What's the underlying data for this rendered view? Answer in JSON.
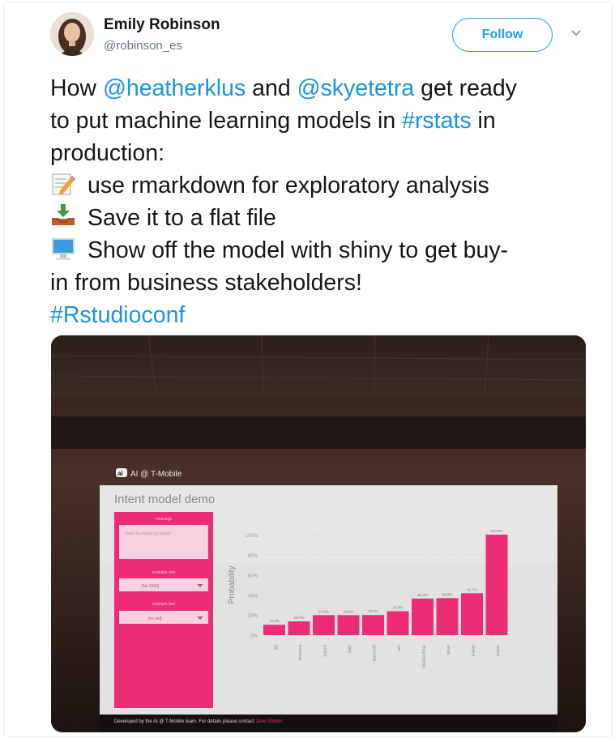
{
  "tweet": {
    "author_name": "Emily Robinson",
    "author_handle": "@robinson_es",
    "follow_label": "Follow",
    "line1": {
      "a": "How ",
      "m1": "@heatherklus",
      "b": " and ",
      "m2": "@skyetetra",
      "c": " get ready"
    },
    "line2": {
      "a": "to put machine learning models in ",
      "tag": "#rstats",
      "b": " in"
    },
    "line3": "production:",
    "bullets": [
      "use rmarkdown for exploratory analysis",
      "Save it to a flat file",
      "Show off the model with shiny to get buy-"
    ],
    "line7": "in from business stakeholders!",
    "hashtag": "#Rstudioconf",
    "colors": {
      "link": "#1b95e0",
      "accent": "#1da1f2",
      "slide_pink": "#ec2d75"
    }
  },
  "slide": {
    "brand": "AI @ T-Mobile",
    "brand_logo_text": "ai",
    "title": "Intent model demo",
    "form": {
      "message_label": "message",
      "message_value": "I want to unlock my phone",
      "select1_label": "example one",
      "select1_value": "[No SMS]",
      "select2_label": "example two",
      "select2_value": "[no sel]"
    },
    "footer_text": "Developed by the AI @ T-Mobile team. For details please contact",
    "footer_contact": "Jane Ellison.",
    "chart_data": {
      "type": "bar",
      "ylabel": "Probability",
      "yticks": [
        "100%",
        "80%",
        "60%",
        "40%",
        "20%",
        "0%"
      ],
      "ylim": [
        0,
        100
      ],
      "categories": [
        "bill",
        "traveling",
        "locked",
        "data",
        "purchase",
        "sim",
        "requirements",
        "email",
        "device",
        "unlock"
      ],
      "values": [
        10.3,
        13.7,
        19.9,
        19.9,
        20.0,
        23.8,
        36.4,
        36.8,
        41.7,
        100.0
      ],
      "labels": [
        "10.3%",
        "13.7%",
        "19.9%",
        "19.9%",
        "20.0%",
        "23.8%",
        "36.4%",
        "36.8%",
        "41.7%",
        "100.0%"
      ]
    }
  }
}
